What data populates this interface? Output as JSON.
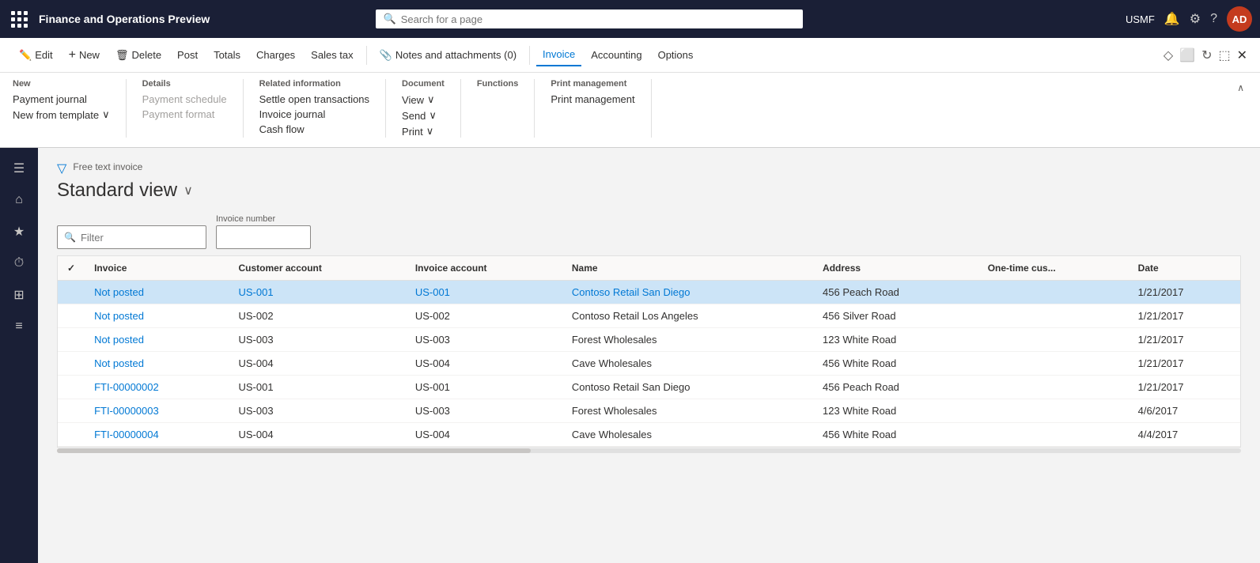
{
  "topbar": {
    "title": "Finance and Operations Preview",
    "search_placeholder": "Search for a page",
    "user_label": "USMF",
    "avatar_initials": "AD"
  },
  "commandbar": {
    "buttons": [
      {
        "id": "edit",
        "label": "Edit",
        "icon": "✏️"
      },
      {
        "id": "new",
        "label": "New",
        "icon": "+"
      },
      {
        "id": "delete",
        "label": "Delete",
        "icon": "🗑"
      },
      {
        "id": "post",
        "label": "Post",
        "icon": ""
      },
      {
        "id": "totals",
        "label": "Totals",
        "icon": ""
      },
      {
        "id": "charges",
        "label": "Charges",
        "icon": ""
      },
      {
        "id": "salestax",
        "label": "Sales tax",
        "icon": ""
      },
      {
        "id": "notesattachments",
        "label": "Notes and attachments (0)",
        "icon": "📎"
      },
      {
        "id": "invoice",
        "label": "Invoice",
        "icon": ""
      },
      {
        "id": "accounting",
        "label": "Accounting",
        "icon": ""
      },
      {
        "id": "options",
        "label": "Options",
        "icon": ""
      }
    ]
  },
  "ribbon": {
    "sections": [
      {
        "title": "New",
        "items": [
          {
            "label": "Payment journal",
            "disabled": false
          },
          {
            "label": "New from template",
            "disabled": false,
            "has_chevron": true
          }
        ]
      },
      {
        "title": "Details",
        "items": [
          {
            "label": "Payment schedule",
            "disabled": true
          },
          {
            "label": "Payment format",
            "disabled": true
          }
        ]
      },
      {
        "title": "Related information",
        "items": [
          {
            "label": "Settle open transactions",
            "disabled": false
          },
          {
            "label": "Invoice journal",
            "disabled": false
          },
          {
            "label": "Cash flow",
            "disabled": false
          }
        ]
      },
      {
        "title": "Document",
        "items": [
          {
            "label": "View",
            "disabled": false,
            "has_chevron": true
          },
          {
            "label": "Send",
            "disabled": false,
            "has_chevron": true
          },
          {
            "label": "Print",
            "disabled": false,
            "has_chevron": true
          }
        ]
      },
      {
        "title": "Functions",
        "items": []
      },
      {
        "title": "Print management",
        "items": [
          {
            "label": "Print management",
            "disabled": false
          }
        ]
      }
    ]
  },
  "sidebar": {
    "icons": [
      {
        "name": "hamburger-icon",
        "symbol": "☰"
      },
      {
        "name": "home-icon",
        "symbol": "⌂"
      },
      {
        "name": "star-icon",
        "symbol": "★"
      },
      {
        "name": "clock-icon",
        "symbol": "⏱"
      },
      {
        "name": "grid-icon",
        "symbol": "⊞"
      },
      {
        "name": "list-icon",
        "symbol": "≡"
      }
    ]
  },
  "main": {
    "breadcrumb": "Free text invoice",
    "page_title": "Standard view",
    "filter_placeholder": "Filter",
    "invoice_number_label": "Invoice number",
    "invoice_number_value": "",
    "table": {
      "columns": [
        {
          "id": "check",
          "label": ""
        },
        {
          "id": "invoice",
          "label": "Invoice"
        },
        {
          "id": "customer_account",
          "label": "Customer account"
        },
        {
          "id": "invoice_account",
          "label": "Invoice account"
        },
        {
          "id": "name",
          "label": "Name"
        },
        {
          "id": "address",
          "label": "Address"
        },
        {
          "id": "one_time_cus",
          "label": "One-time cus..."
        },
        {
          "id": "date",
          "label": "Date"
        }
      ],
      "rows": [
        {
          "invoice": "Not posted",
          "customer_account": "US-001",
          "invoice_account": "US-001",
          "name": "Contoso Retail San Diego",
          "address": "456 Peach Road",
          "one_time_cus": "",
          "date": "1/21/2017",
          "selected": true,
          "invoice_link": true,
          "customer_link": true,
          "inv_account_link": true,
          "name_link": true
        },
        {
          "invoice": "Not posted",
          "customer_account": "US-002",
          "invoice_account": "US-002",
          "name": "Contoso Retail Los Angeles",
          "address": "456 Silver Road",
          "one_time_cus": "",
          "date": "1/21/2017",
          "selected": false,
          "invoice_link": true,
          "customer_link": false,
          "inv_account_link": false,
          "name_link": false
        },
        {
          "invoice": "Not posted",
          "customer_account": "US-003",
          "invoice_account": "US-003",
          "name": "Forest Wholesales",
          "address": "123 White Road",
          "one_time_cus": "",
          "date": "1/21/2017",
          "selected": false,
          "invoice_link": true,
          "customer_link": false,
          "inv_account_link": false,
          "name_link": false
        },
        {
          "invoice": "Not posted",
          "customer_account": "US-004",
          "invoice_account": "US-004",
          "name": "Cave Wholesales",
          "address": "456 White Road",
          "one_time_cus": "",
          "date": "1/21/2017",
          "selected": false,
          "invoice_link": true,
          "customer_link": false,
          "inv_account_link": false,
          "name_link": false
        },
        {
          "invoice": "FTI-00000002",
          "customer_account": "US-001",
          "invoice_account": "US-001",
          "name": "Contoso Retail San Diego",
          "address": "456 Peach Road",
          "one_time_cus": "",
          "date": "1/21/2017",
          "selected": false,
          "invoice_link": true,
          "customer_link": false,
          "inv_account_link": false,
          "name_link": false
        },
        {
          "invoice": "FTI-00000003",
          "customer_account": "US-003",
          "invoice_account": "US-003",
          "name": "Forest Wholesales",
          "address": "123 White Road",
          "one_time_cus": "",
          "date": "4/6/2017",
          "selected": false,
          "invoice_link": true,
          "customer_link": false,
          "inv_account_link": false,
          "name_link": false
        },
        {
          "invoice": "FTI-00000004",
          "customer_account": "US-004",
          "invoice_account": "US-004",
          "name": "Cave Wholesales",
          "address": "456 White Road",
          "one_time_cus": "",
          "date": "4/4/2017",
          "selected": false,
          "invoice_link": true,
          "customer_link": false,
          "inv_account_link": false,
          "name_link": false
        }
      ]
    }
  }
}
